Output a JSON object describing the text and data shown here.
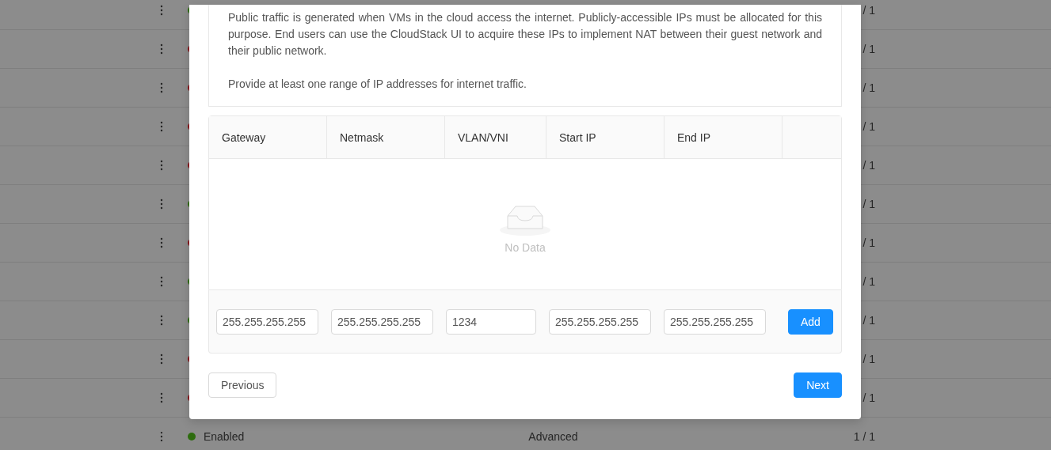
{
  "background_rows": [
    {
      "color": "#2d6c0e",
      "count": "/ 1"
    },
    {
      "color": "#871319",
      "count": "/ 1"
    },
    {
      "color": "#871319",
      "count": "/ 1"
    },
    {
      "color": "#871319",
      "count": "/ 1"
    },
    {
      "color": "#871319",
      "count": "/ 1"
    },
    {
      "color": "#2d6c0e",
      "count": "/ 1"
    },
    {
      "color": "#871319",
      "count": "/ 1"
    },
    {
      "color": "#2d6c0e",
      "count": "/ 1"
    },
    {
      "color": "#2d6c0e",
      "count": "/ 1"
    },
    {
      "color": "#871319",
      "count": "/ 1"
    },
    {
      "color": "#871319",
      "count": "/ 1"
    },
    {
      "color": "#2d6c0e",
      "status": "Enabled",
      "type": "Advanced",
      "count": "1 / 1"
    }
  ],
  "dialog": {
    "description": [
      "Public traffic is generated when VMs in the cloud access the internet. Publicly-accessible IPs must be allocated for this purpose. End users can use the CloudStack UI to acquire these IPs to implement NAT between their guest network and their public network.",
      "Provide at least one range of IP addresses for internet traffic."
    ],
    "table": {
      "columns": [
        "Gateway",
        "Netmask",
        "VLAN/VNI",
        "Start IP",
        "End IP"
      ],
      "empty_text": "No Data"
    },
    "inputs": [
      {
        "value": "255.255.255.255"
      },
      {
        "value": "255.255.255.255"
      },
      {
        "value": "1234"
      },
      {
        "value": "255.255.255.255"
      },
      {
        "value": "255.255.255.255"
      }
    ],
    "add_button": "Add",
    "previous_button": "Previous",
    "next_button": "Next"
  }
}
